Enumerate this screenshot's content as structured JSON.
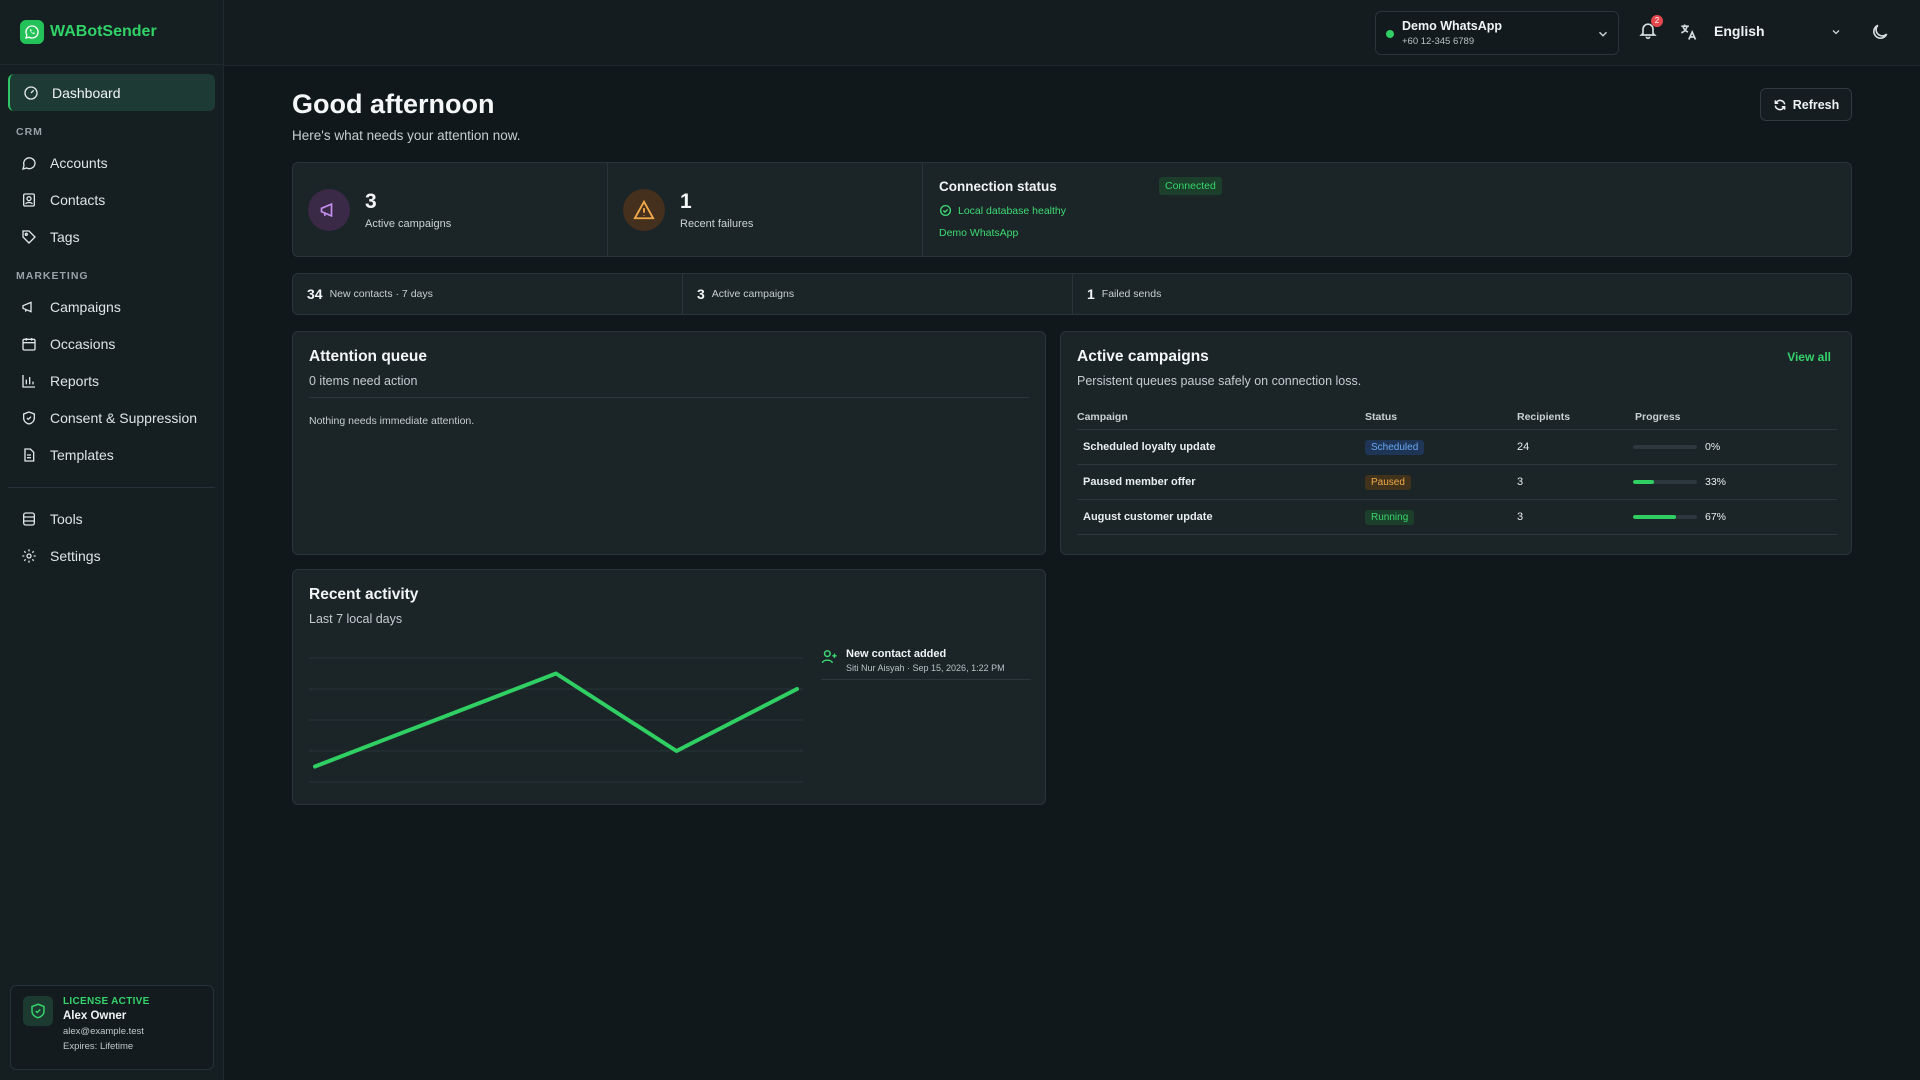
{
  "brand": {
    "name": "WABotSender"
  },
  "sidebar": {
    "dashboard": "Dashboard",
    "group_crm": "CRM",
    "crm_items": [
      "Accounts",
      "Contacts",
      "Tags"
    ],
    "group_marketing": "MARKETING",
    "marketing_items": [
      "Campaigns",
      "Occasions",
      "Reports",
      "Consent & Suppression",
      "Templates"
    ],
    "tool_items": [
      "Tools",
      "Settings"
    ]
  },
  "license": {
    "status": "LICENSE ACTIVE",
    "name": "Alex Owner",
    "email": "alex@example.test",
    "expires": "Expires: Lifetime"
  },
  "header": {
    "account_name": "Demo WhatsApp",
    "account_phone": "+60 12-345 6789",
    "notification_count": "2",
    "language": "English"
  },
  "page": {
    "greeting": "Good afternoon",
    "subtitle": "Here's what needs your attention now.",
    "refresh_label": "Refresh"
  },
  "stats": {
    "active_campaigns_value": "3",
    "active_campaigns_label": "Active campaigns",
    "failures_value": "1",
    "failures_label": "Recent failures",
    "connection_title": "Connection status",
    "connection_badge": "Connected",
    "db_status": "Local database healthy",
    "connection_account": "Demo WhatsApp"
  },
  "summary": [
    {
      "value": "34",
      "label": "New contacts · 7 days"
    },
    {
      "value": "3",
      "label": "Active campaigns"
    },
    {
      "value": "1",
      "label": "Failed sends"
    }
  ],
  "attention": {
    "title": "Attention queue",
    "subtitle": "0 items need action",
    "empty": "Nothing needs immediate attention."
  },
  "campaigns": {
    "title": "Active campaigns",
    "subtitle": "Persistent queues pause safely on connection loss.",
    "view_all": "View all",
    "columns": [
      "Campaign",
      "Status",
      "Recipients",
      "Progress"
    ],
    "rows": [
      {
        "name": "Scheduled loyalty update",
        "status": "Scheduled",
        "recipients": "24",
        "progress": 0,
        "progress_label": "0%"
      },
      {
        "name": "Paused member offer",
        "status": "Paused",
        "recipients": "3",
        "progress": 33,
        "progress_label": "33%"
      },
      {
        "name": "August customer update",
        "status": "Running",
        "recipients": "3",
        "progress": 67,
        "progress_label": "67%"
      }
    ]
  },
  "activity": {
    "title": "Recent activity",
    "subtitle": "Last 7 local days",
    "event_title": "New contact added",
    "event_meta": "Siti Nur Aisyah · Sep 15, 2026, 1:22 PM"
  },
  "chart_data": {
    "type": "line",
    "title": "",
    "xlabel": "",
    "ylabel": "",
    "ylim": [
      0,
      8
    ],
    "grid": true,
    "series": [
      {
        "values": [
          1,
          4,
          7,
          2,
          6
        ]
      }
    ],
    "colors": {
      "line": "#2fcf63"
    }
  },
  "colors": {
    "accent": "#2fcf63",
    "background": "#10181b",
    "card": "#1b2427"
  }
}
